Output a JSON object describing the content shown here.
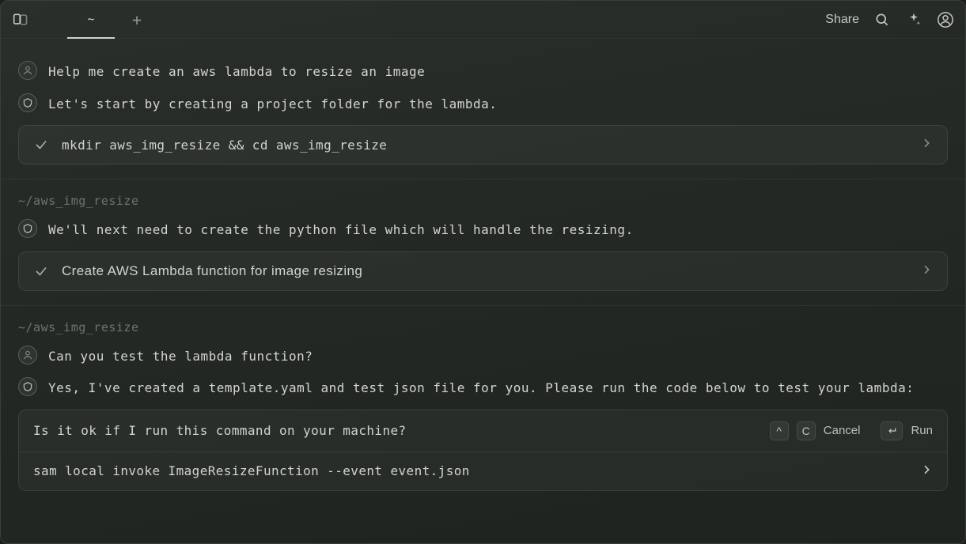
{
  "titlebar": {
    "tab_label": "~",
    "share_label": "Share"
  },
  "sections": [
    {
      "path": "",
      "messages": [
        {
          "role": "user",
          "text": "Help me create an aws lambda to resize an image"
        },
        {
          "role": "ai",
          "text": "Let's start by creating a project folder for the lambda."
        }
      ],
      "card": {
        "kind": "mono",
        "text": "mkdir aws_img_resize && cd aws_img_resize"
      }
    },
    {
      "path": "~/aws_img_resize",
      "messages": [
        {
          "role": "ai",
          "text": "We'll next need to create the python file which will handle the resizing."
        }
      ],
      "card": {
        "kind": "sans",
        "text": "Create AWS Lambda function for image resizing"
      }
    },
    {
      "path": "~/aws_img_resize",
      "messages": [
        {
          "role": "user",
          "text": "Can you test the lambda function?"
        },
        {
          "role": "ai",
          "text": "Yes, I've created a template.yaml and test json file for you. Please run the code below to test your lambda:"
        }
      ],
      "prompt": {
        "question": "Is it ok if I run this command on your machine?",
        "cancel_key": "^",
        "cancel_label2": "C",
        "cancel_text": "Cancel",
        "run_key_glyph": "↩",
        "run_text": "Run",
        "command": "sam local invoke ImageResizeFunction --event event.json"
      }
    }
  ]
}
